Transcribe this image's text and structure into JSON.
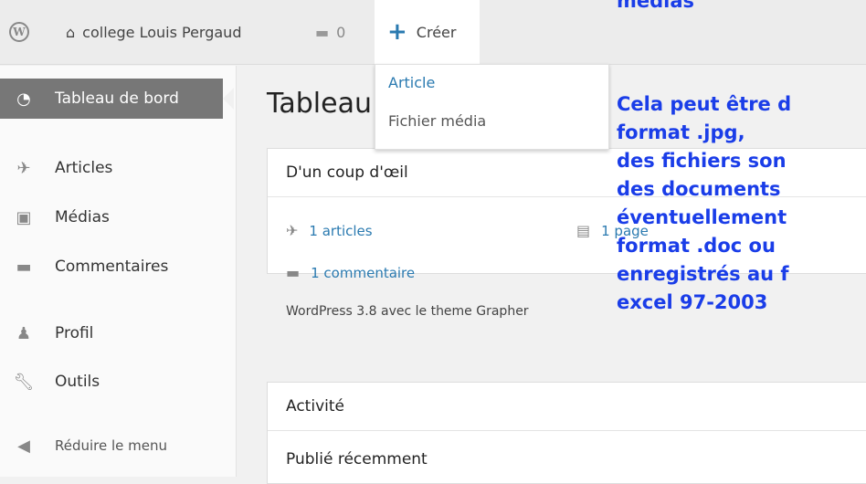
{
  "adminbar": {
    "logo_icon": "wordpress-logo-icon",
    "site_name": "college Louis Pergaud",
    "comments_count": "0",
    "new_label": "Créer",
    "new_menu": [
      "Article",
      "Fichier média"
    ]
  },
  "sidebar": {
    "items": [
      {
        "label": "Tableau de bord",
        "icon": "dashboard-icon"
      },
      {
        "label": "Articles",
        "icon": "pin-icon"
      },
      {
        "label": "Médias",
        "icon": "media-icon"
      },
      {
        "label": "Commentaires",
        "icon": "comment-icon"
      },
      {
        "label": "Profil",
        "icon": "user-icon"
      },
      {
        "label": "Outils",
        "icon": "wrench-icon"
      },
      {
        "label": "Réduire le menu",
        "icon": "collapse-icon"
      }
    ]
  },
  "main": {
    "page_title": "Tableau",
    "glance": {
      "title": "D'un coup d'œil",
      "articles": "1 articles",
      "page": "1 page",
      "comment": "1 commentaire",
      "footer": "WordPress 3.8 avec le theme Grapher"
    },
    "activity": {
      "title": "Activité",
      "recent": "Publié récemment"
    }
  },
  "overlay": {
    "top_text": "médias",
    "lines": [
      " Cela peut être d",
      "format  .jpg,",
      "des fichiers son",
      "des documents",
      "éventuellement",
      "format  .doc ou",
      "enregistrés au f",
      "excel 97-2003"
    ]
  },
  "colors": {
    "link": "#2a7ab0",
    "overlay_text": "#1a3de8",
    "active_menu": "#777777"
  }
}
